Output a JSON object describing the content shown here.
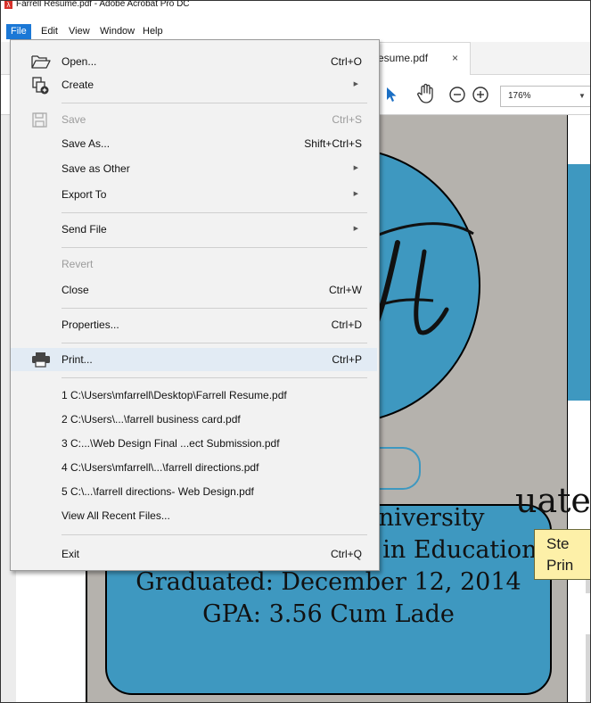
{
  "window": {
    "title": "Farrell Resume.pdf - Adobe Acrobat Pro DC"
  },
  "menubar": {
    "items": [
      "File",
      "Edit",
      "View",
      "Window",
      "Help"
    ]
  },
  "tab": {
    "label": "esume.pdf",
    "close": "×"
  },
  "toolbar": {
    "zoom": "176%"
  },
  "file_menu": {
    "items": [
      {
        "label": "Open...",
        "mnemonic": "O",
        "shortcut": "Ctrl+O",
        "icon": "folder-open-icon",
        "enabled": true
      },
      {
        "label": "Create",
        "mnemonic": "r",
        "submenu": true,
        "icon": "create-pdf-icon",
        "enabled": true
      },
      {
        "label": "Save",
        "mnemonic": "S",
        "shortcut": "Ctrl+S",
        "icon": "save-icon",
        "enabled": false
      },
      {
        "label": "Save As...",
        "mnemonic": "A",
        "shortcut": "Shift+Ctrl+S",
        "enabled": true
      },
      {
        "label": "Save as Other",
        "mnemonic": "h",
        "submenu": true,
        "enabled": true
      },
      {
        "label": "Export To",
        "mnemonic": "t",
        "submenu": true,
        "enabled": true
      },
      {
        "label": "Send File",
        "mnemonic": "l",
        "submenu": true,
        "enabled": true
      },
      {
        "label": "Revert",
        "mnemonic": "v",
        "enabled": false
      },
      {
        "label": "Close",
        "mnemonic": "C",
        "shortcut": "Ctrl+W",
        "enabled": true
      },
      {
        "label": "Properties...",
        "mnemonic": "e",
        "shortcut": "Ctrl+D",
        "enabled": true
      },
      {
        "label": "Print...",
        "mnemonic": "P",
        "shortcut": "Ctrl+P",
        "icon": "printer-icon",
        "enabled": true,
        "highlighted": true
      },
      {
        "label": "1 C:\\Users\\mfarrell\\Desktop\\Farrell Resume.pdf",
        "recent": true
      },
      {
        "label": "2 C:\\Users\\...\\farrell business card.pdf",
        "recent": true
      },
      {
        "label": "3 C:...\\Web Design Final ...ect Submission.pdf",
        "recent": true
      },
      {
        "label": "4 C:\\Users\\mfarrell\\...\\farrell directions.pdf",
        "recent": true
      },
      {
        "label": "5 C:\\...\\farrell directions- Web Design.pdf",
        "recent": true
      },
      {
        "label": "View All Recent Files...",
        "mnemonic": "F",
        "enabled": true
      },
      {
        "label": "Exit",
        "mnemonic": "x",
        "shortcut": "Ctrl+Q",
        "enabled": true
      }
    ]
  },
  "callout": {
    "line1": "Ste",
    "line2": "Prin"
  },
  "document": {
    "partial_heading": "uate",
    "lines": [
      "Missouri State University",
      "Bachelors of Science in Education",
      "Graduated: December 12, 2014",
      "GPA: 3.56 Cum Lade"
    ]
  },
  "colors": {
    "accent_blue": "#3e98c0",
    "menu_active": "#1b78d6",
    "menu_hover": "#e2ebf4",
    "callout_bg": "#fdf0a8"
  }
}
